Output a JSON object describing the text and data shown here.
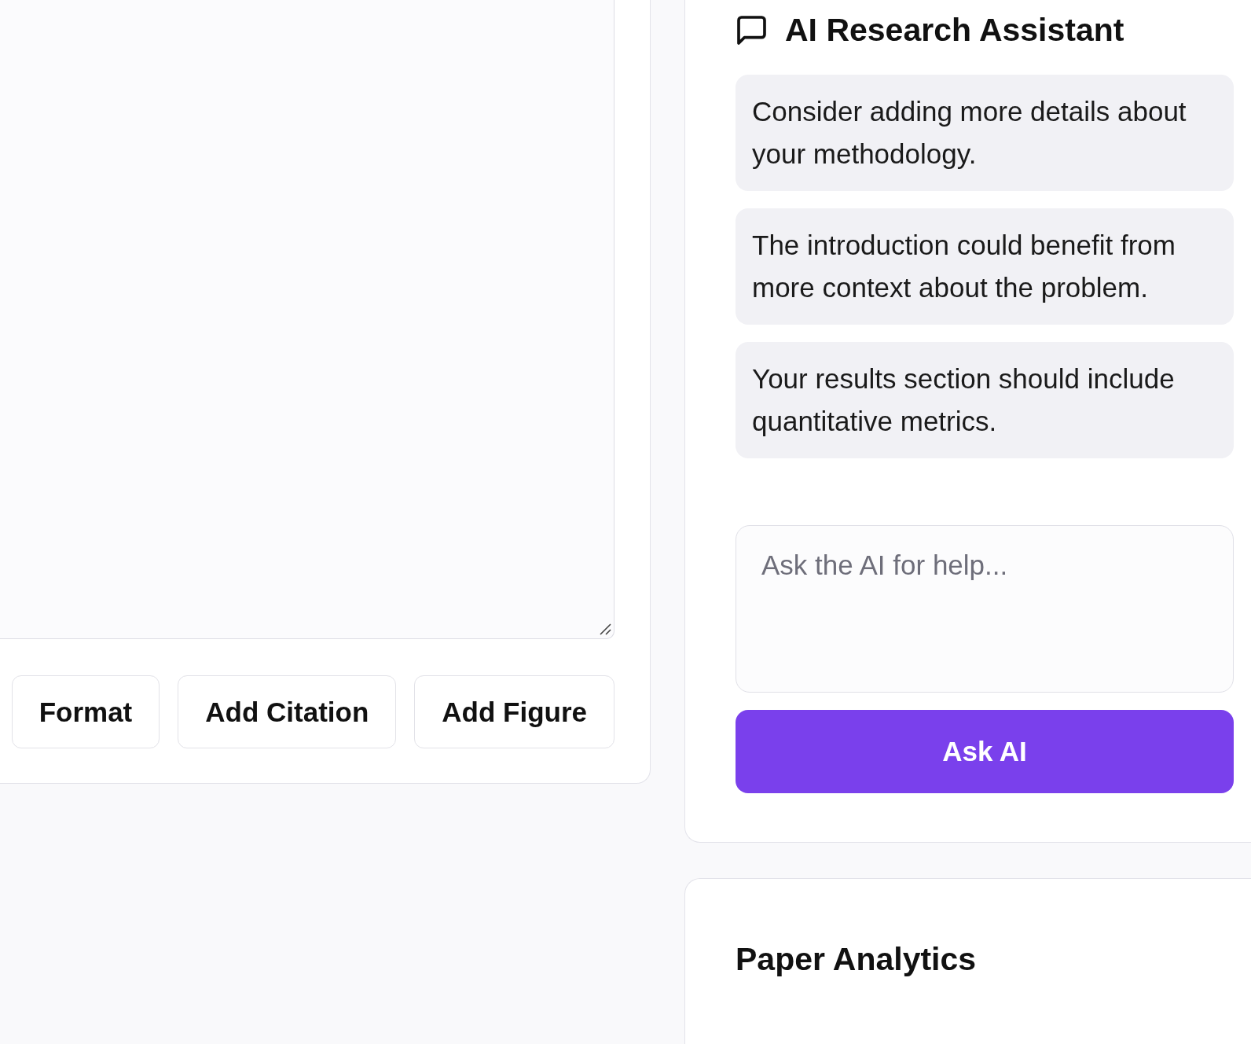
{
  "editor": {
    "toolbar_buttons": [
      "Format",
      "Add Citation",
      "Add Figure"
    ]
  },
  "assistant": {
    "title": "AI Research Assistant",
    "suggestions": [
      "Consider adding more details about your methodology.",
      "The introduction could benefit from more context about the problem.",
      "Your results section should include quantitative metrics."
    ],
    "prompt": {
      "placeholder": "Ask the AI for help..."
    },
    "submit_button": "Ask AI"
  },
  "analytics": {
    "title": "Paper Analytics"
  }
}
